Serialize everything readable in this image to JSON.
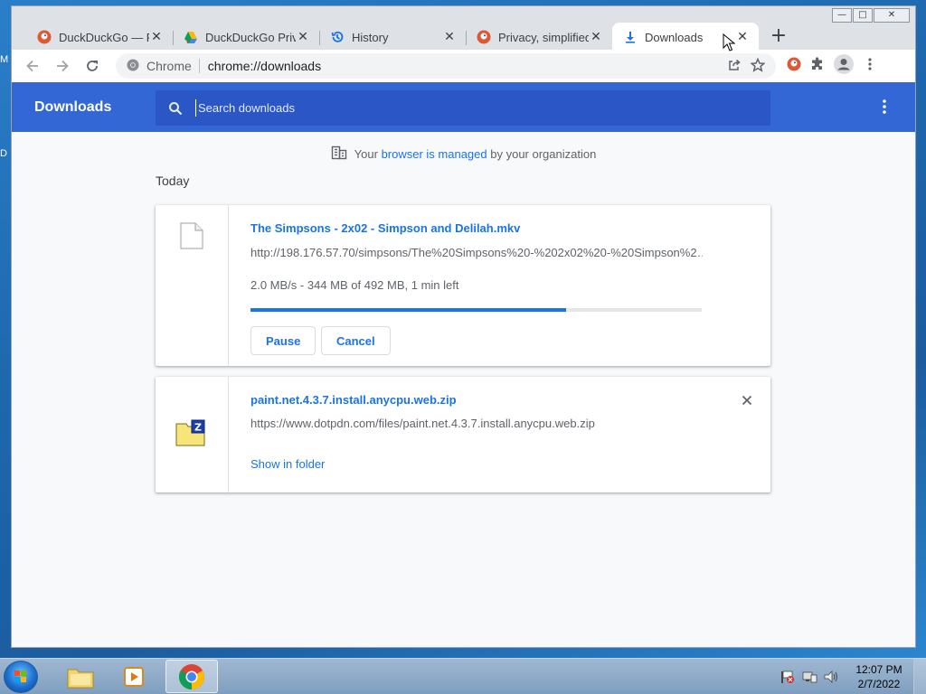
{
  "desktop": {
    "left_glyph_1": "M",
    "left_glyph_2": "D"
  },
  "window": {
    "minimize": "—",
    "maximize": "□",
    "close": "✕"
  },
  "tabs": [
    {
      "title": "DuckDuckGo — Pr",
      "icon": "duckduckgo-icon"
    },
    {
      "title": "DuckDuckGo Priva",
      "icon": "google-drive-icon"
    },
    {
      "title": "History",
      "icon": "history-icon"
    },
    {
      "title": "Privacy, simplified",
      "icon": "duckduckgo-icon"
    },
    {
      "title": "Downloads",
      "icon": "download-icon",
      "active": true
    }
  ],
  "tab_close": "✕",
  "new_tab": "+",
  "omnibox": {
    "scheme_label": "Chrome",
    "url_host": "chrome://",
    "url_path": "downloads"
  },
  "downloads": {
    "title": "Downloads",
    "search_placeholder": "Search downloads",
    "managed": {
      "before": "Your",
      "link": "browser is managed",
      "after": "by your organization"
    },
    "section": "Today",
    "items": [
      {
        "name": "The Simpsons - 2x02 - Simpson and Delilah.mkv",
        "url": "http://198.176.57.70/simpsons/The%20Simpsons%20-%202x02%20-%20Simpson%2…",
        "status": "2.0 MB/s - 344 MB of 492 MB, 1 min left",
        "progress": 0.699,
        "pause_label": "Pause",
        "cancel_label": "Cancel"
      },
      {
        "name": "paint.net.4.3.7.install.anycpu.web.zip",
        "url": "https://www.dotpdn.com/files/paint.net.4.3.7.install.anycpu.web.zip",
        "show_label": "Show in folder"
      }
    ]
  },
  "colors": {
    "accent": "#1a73e8",
    "header": "#3367d6",
    "search_bg": "#2a56c6"
  },
  "taskbar": {
    "time": "12:07 PM",
    "date": "2/7/2022"
  }
}
